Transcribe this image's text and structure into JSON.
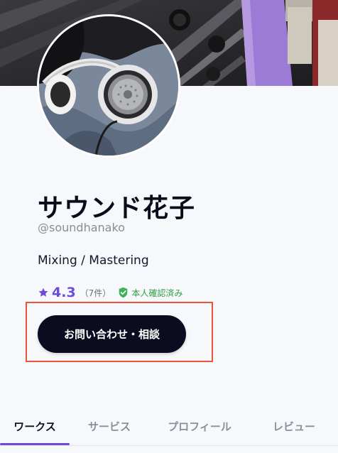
{
  "profile": {
    "display_name": "サウンド花子",
    "handle": "@soundhanako",
    "job_title": "Mixing / Mastering"
  },
  "rating": {
    "score": "4.3",
    "review_count": "（7件）",
    "verified_label": "本人確認済み"
  },
  "actions": {
    "contact_label": "お問い合わせ・相談"
  },
  "tabs": [
    {
      "label": "ワークス",
      "active": true
    },
    {
      "label": "サービス",
      "active": false
    },
    {
      "label": "プロフィール",
      "active": false
    },
    {
      "label": "レビュー",
      "active": false
    }
  ],
  "colors": {
    "accent": "#6e4ad8",
    "button": "#0b0c1f",
    "verified": "#2f9e44",
    "highlight": "#e8553a"
  },
  "icons": {
    "rating": "star-icon",
    "verified": "verified-shield-icon"
  }
}
